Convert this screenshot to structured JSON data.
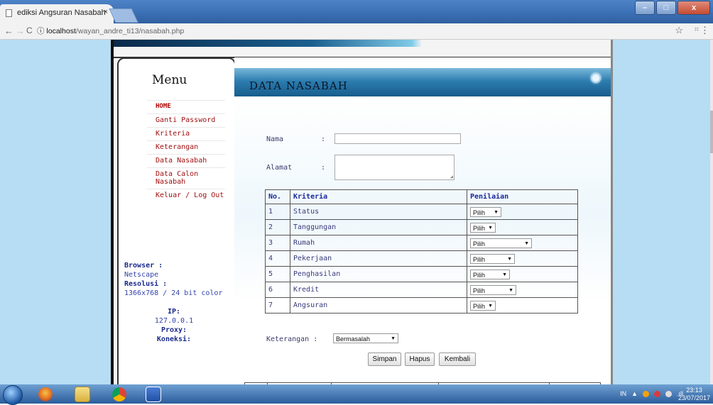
{
  "browser": {
    "tab_title": "ediksi Angsuran Nasabah",
    "tab_close": "×",
    "url_host": "localhost",
    "url_path": "/wayan_andre_ti13/nasabah.php",
    "back_icon": "←",
    "forward_icon": "→",
    "reload_icon": "C",
    "info_icon": "ⓘ",
    "star_icon": "☆",
    "ext_icon": "⌗",
    "menu_icon": "⋮",
    "min_icon": "–",
    "max_icon": "□",
    "close_icon": "x"
  },
  "sidebar": {
    "title": "Menu",
    "items": [
      {
        "label": "HOME"
      },
      {
        "label": "Ganti Password"
      },
      {
        "label": "Kriteria"
      },
      {
        "label": "Keterangan"
      },
      {
        "label": "Data Nasabah"
      },
      {
        "label": "Data Calon Nasabah"
      },
      {
        "label": "Keluar / Log Out"
      }
    ],
    "browser_label": "Browser :",
    "browser_value": "Netscape",
    "resolusi_label": "Resolusi :",
    "resolusi_value": "1366x768 / 24 bit color",
    "ip_label": "IP:",
    "ip_value": "127.0.0.1",
    "proxy_label": "Proxy:",
    "koneksi_label": "Koneksi:"
  },
  "main": {
    "title": "DATA NASABAH",
    "nama_label": "Nama",
    "alamat_label": "Alamat",
    "colon": ":",
    "nama_value": "",
    "alamat_value": "",
    "table_headers": {
      "no": "No.",
      "kriteria": "Kriteria",
      "penilaian": "Penilaian"
    },
    "rows": [
      {
        "no": "1",
        "kriteria": "Status",
        "value": "Pilih"
      },
      {
        "no": "2",
        "kriteria": "Tanggungan",
        "value": "Pilih"
      },
      {
        "no": "3",
        "kriteria": "Rumah",
        "value": "Pilih"
      },
      {
        "no": "4",
        "kriteria": "Pekerjaan",
        "value": "Pilih"
      },
      {
        "no": "5",
        "kriteria": "Penghasilan",
        "value": "Pilih"
      },
      {
        "no": "6",
        "kriteria": "Kredit",
        "value": "Pilih"
      },
      {
        "no": "7",
        "kriteria": "Angsuran",
        "value": "Pilih"
      }
    ],
    "keterangan_label": "Keterangan :",
    "keterangan_value": "Bermasalah",
    "buttons": {
      "simpan": "Simpan",
      "hapus": "Hapus",
      "kembali": "Kembali"
    }
  },
  "taskbar": {
    "lang": "IN",
    "tray_arrow": "▲",
    "signal": ".ıll",
    "time": "23:13",
    "date": "23/07/2017"
  }
}
